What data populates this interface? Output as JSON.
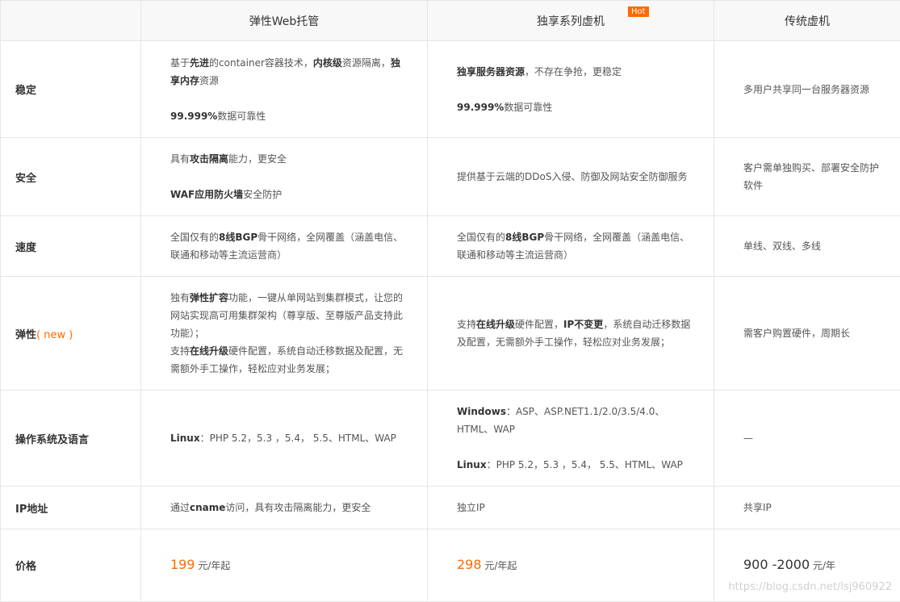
{
  "headers": {
    "col1": "弹性Web托管",
    "col2": "独享系列虚机",
    "col2_badge": "Hot",
    "col3": "传统虚机"
  },
  "rows": {
    "stability": {
      "label": "稳定",
      "c1_p1_t1": "基于",
      "c1_p1_b1": "先进",
      "c1_p1_t2": "的container容器技术，",
      "c1_p1_b2": "内核级",
      "c1_p1_t3": "资源隔离，",
      "c1_p1_b3": "独享内存",
      "c1_p1_t4": "资源",
      "c1_p2_b": "99.999%",
      "c1_p2_t": "数据可靠性",
      "c2_p1_b": "独享服务器资源",
      "c2_p1_t": "，不存在争抢，更稳定",
      "c2_p2_b": "99.999%",
      "c2_p2_t": "数据可靠性",
      "c3": "多用户共享同一台服务器资源"
    },
    "security": {
      "label": "安全",
      "c1_p1_t1": "具有",
      "c1_p1_b": "攻击隔离",
      "c1_p1_t2": "能力，更安全",
      "c1_p2_b": "WAF应用防火墙",
      "c1_p2_t": "安全防护",
      "c2": "提供基于云端的DDoS入侵、防御及网站安全防御服务",
      "c3": "客户需单独购买、部署安全防护软件"
    },
    "speed": {
      "label": "速度",
      "c1_t1": "全国仅有的",
      "c1_b": "8线BGP",
      "c1_t2": "骨干网络，全网覆盖（涵盖电信、联通和移动等主流运营商）",
      "c2_t1": "全国仅有的",
      "c2_b": "8线BGP",
      "c2_t2": "骨干网络，全网覆盖（涵盖电信、联通和移动等主流运营商）",
      "c3": "单线、双线、多线"
    },
    "elasticity": {
      "label": "弹性",
      "label_open": "( ",
      "label_new": "new",
      "label_close": " )",
      "c1_t1": "独有",
      "c1_b1": "弹性扩容",
      "c1_t2": "功能，一键从单网站到集群模式，让您的网站实现高可用集群架构（尊享版、至尊版产品支持此功能）；",
      "c1_t3": "支持",
      "c1_b2": "在线升级",
      "c1_t4": "硬件配置，系统自动迁移数据及配置，无需额外手工操作，轻松应对业务发展；",
      "c2_t1": "支持",
      "c2_b1": "在线升级",
      "c2_t2": "硬件配置，",
      "c2_b2": "IP不变更",
      "c2_t3": "，系统自动迁移数据及配置，无需额外手工操作，轻松应对业务发展；",
      "c3": "需客户购置硬件，周期长"
    },
    "os": {
      "label": "操作系统及语言",
      "c1_b": "Linux",
      "c1_t": "：PHP 5.2，5.3 ，5.4， 5.5、HTML、WAP",
      "c2_p1_b": "Windows",
      "c2_p1_t": "：ASP、ASP.NET1.1/2.0/3.5/4.0、HTML、WAP",
      "c2_p2_b": "Linux",
      "c2_p2_t": "：PHP 5.2，5.3 ，5.4， 5.5、HTML、WAP",
      "c3": "—"
    },
    "ip": {
      "label": "IP地址",
      "c1_t1": "通过",
      "c1_b": "cname",
      "c1_t2": "访问，具有攻击隔离能力，更安全",
      "c2": "独立IP",
      "c3": "共享IP"
    },
    "price": {
      "label": "价格",
      "c1_value": "199",
      "c1_unit": " 元/年起",
      "c2_value": "298",
      "c2_unit": " 元/年起",
      "c3_value": "900 -2000",
      "c3_unit": " 元/年"
    }
  },
  "watermark": "https://blog.csdn.net/lsj960922",
  "colors": {
    "accent": "#ff6a00",
    "header_bg": "#f8f8f8",
    "border": "#e6e6e6"
  }
}
